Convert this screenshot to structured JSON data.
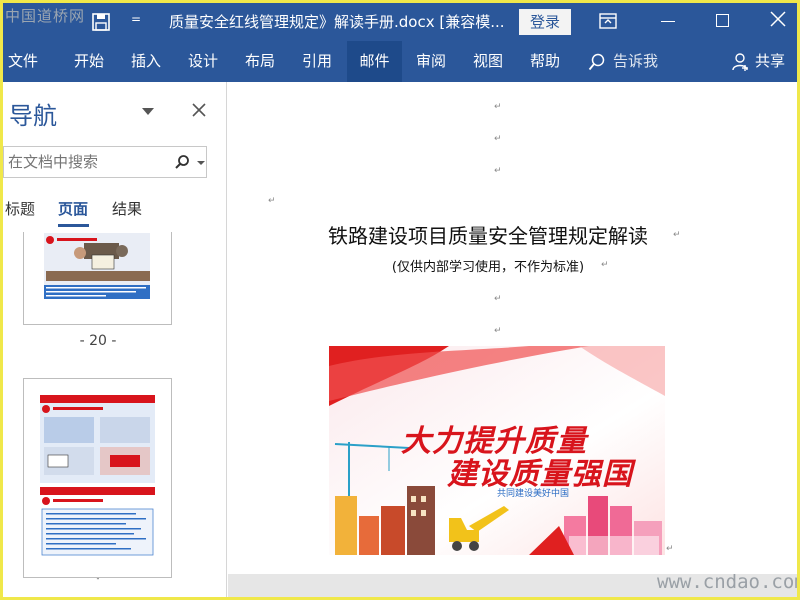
{
  "watermarks": {
    "top_left": "中国道桥网",
    "bottom_right": "www.cndao.com"
  },
  "titlebar": {
    "qat_more": "=",
    "document_title": "质量安全红线管理规定》解读手册.docx [兼容模...",
    "login_label": "登录"
  },
  "ribbon": {
    "tabs": [
      "文件",
      "开始",
      "插入",
      "设计",
      "布局",
      "引用",
      "邮件",
      "审阅",
      "视图",
      "帮助"
    ],
    "active_tab": "邮件",
    "tell_me": "告诉我",
    "share": "共享"
  },
  "nav": {
    "title": "导航",
    "search_placeholder": "在文档中搜索",
    "tabs": [
      "标题",
      "页面",
      "结果"
    ],
    "active_tab": "页面",
    "page_label_1": "- 20 -",
    "page_label_2": "-"
  },
  "document": {
    "heading": "铁路建设项目质量安全管理规定解读",
    "subheading": "(仅供内部学习使用，不作为标准)",
    "para_mark": "↵",
    "poster": {
      "line1": "大力提升质量",
      "line2": "建设质量强国",
      "tagline": "共同建设美好中国"
    }
  },
  "colors": {
    "ribbon_blue": "#2b579a",
    "active_tab": "#1e4a8a",
    "poster_red": "#d8141c"
  }
}
